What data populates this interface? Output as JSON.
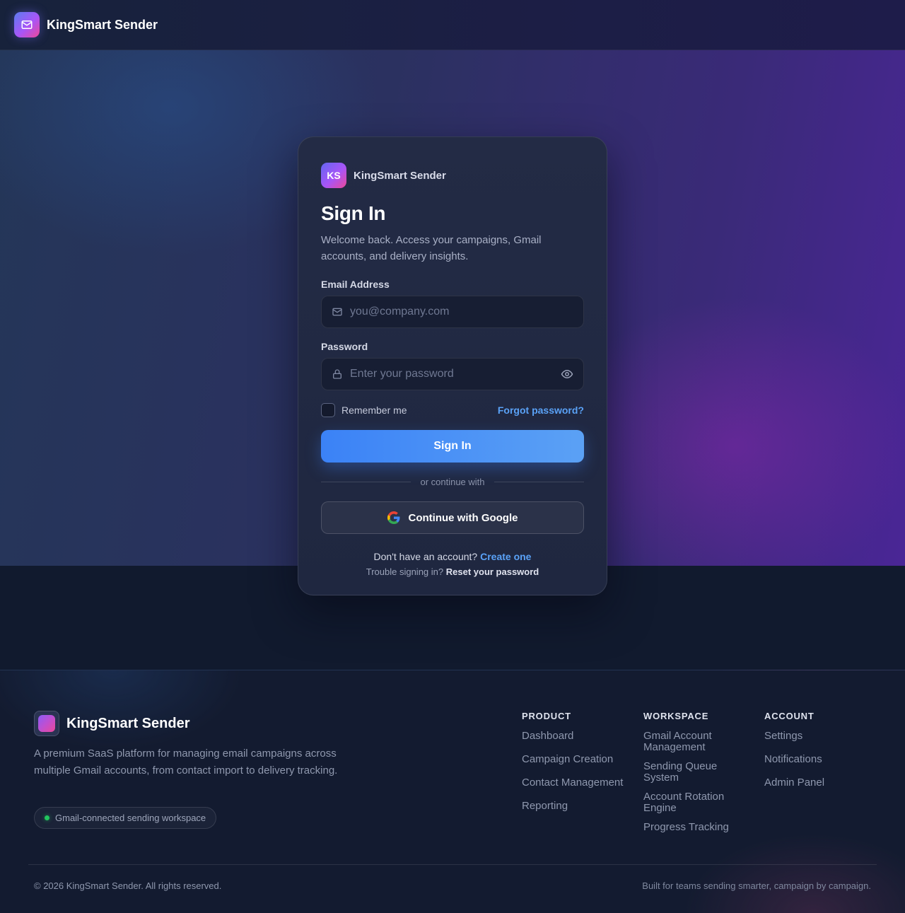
{
  "nav": {
    "app_name": "KingSmart Sender",
    "logo_icon": "mail-icon"
  },
  "card": {
    "badge": "KS",
    "brand": "KingSmart Sender",
    "title": "Sign In",
    "subtitle": "Welcome back. Access your campaigns, Gmail accounts, and delivery insights.",
    "email": {
      "label": "Email Address",
      "placeholder": "you@company.com",
      "value": ""
    },
    "password": {
      "label": "Password",
      "placeholder": "Enter your password",
      "value": ""
    },
    "remember_label": "Remember me",
    "remember_checked": false,
    "forgot_label": "Forgot password?",
    "signin_label": "Sign In",
    "divider_text": "or continue with",
    "google_label": "Continue with Google",
    "signup_prompt": "Don't have an account?",
    "signup_link": "Create one",
    "trouble_prompt": "Trouble signing in?",
    "trouble_link": "Reset your password"
  },
  "footer": {
    "brand": "KingSmart Sender",
    "description": "A premium SaaS platform for managing email campaigns across multiple Gmail accounts, from contact import to delivery tracking.",
    "status_pill": "Gmail-connected sending workspace",
    "columns": [
      {
        "title": "PRODUCT",
        "items": [
          "Dashboard",
          "Campaign Creation",
          "Contact Management",
          "Reporting"
        ]
      },
      {
        "title": "WORKSPACE",
        "items": [
          "Gmail Account Management",
          "Sending Queue System",
          "Account Rotation Engine",
          "Progress Tracking"
        ]
      },
      {
        "title": "ACCOUNT",
        "items": [
          "Settings",
          "Notifications",
          "Admin Panel"
        ]
      }
    ],
    "copyright": "© 2026 KingSmart Sender. All rights reserved.",
    "tagline": "Built for teams sending smarter, campaign by campaign."
  },
  "colors": {
    "accent": "#3b82f6",
    "link": "#5aa2f7",
    "status_dot": "#22c55e"
  }
}
